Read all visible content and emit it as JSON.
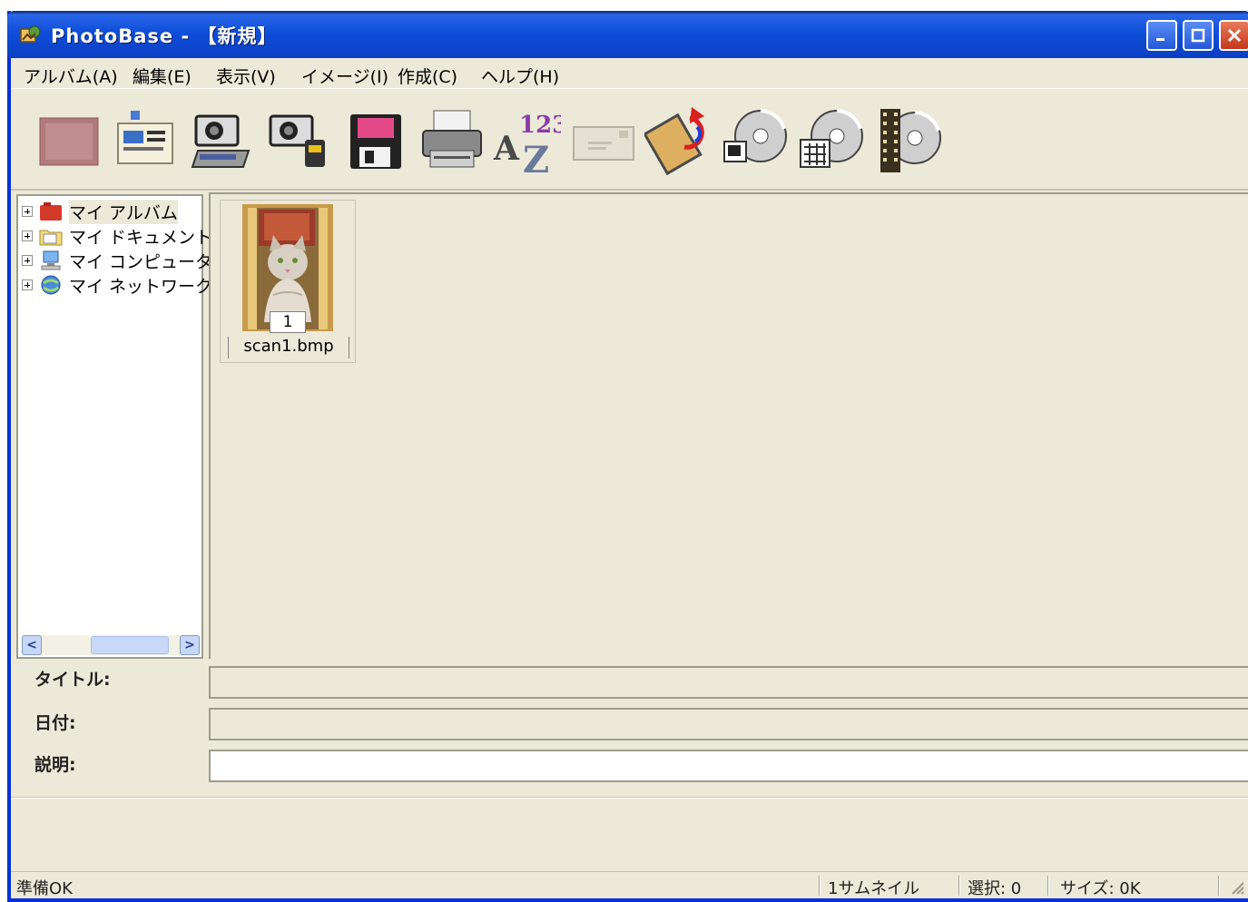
{
  "window": {
    "title": "PhotoBase - 【新規】"
  },
  "menu": [
    "アルバム(A)",
    "編集(E)",
    "表示(V)",
    "イメージ(I)",
    "作成(C)",
    "ヘルプ(H)"
  ],
  "toolbar": {
    "icons": [
      "album-icon",
      "properties-icon",
      "scanner-camera-icon",
      "camera-card-icon",
      "floppy-save-icon",
      "printer-icon",
      "sort-az-icon",
      "email-icon",
      "rotate-icon",
      "cd-slideshow-icon",
      "cd-calendar-icon",
      "cd-film-icon"
    ]
  },
  "tree": {
    "items": [
      {
        "label": "マイ アルバム",
        "icon": "album-icon"
      },
      {
        "label": "マイ ドキュメント",
        "icon": "documents-folder-icon"
      },
      {
        "label": "マイ コンピュータ",
        "icon": "computer-icon"
      },
      {
        "label": "マイ ネットワーク",
        "icon": "network-icon"
      }
    ]
  },
  "thumbnail": {
    "number": "1",
    "filename": "scan1.bmp"
  },
  "properties": {
    "title_label": "タイトル:",
    "date_label": "日付:",
    "description_label": "説明:",
    "title_value": "",
    "date_value": "",
    "description_value": ""
  },
  "status": {
    "ready": "準備OK",
    "thumbnails": "1サムネイル",
    "selection": "選択: 0",
    "size": "サイズ: 0K"
  },
  "colors": {
    "titlebar": "#0f4ed8",
    "face": "#ece9d8",
    "close": "#c4381c"
  }
}
